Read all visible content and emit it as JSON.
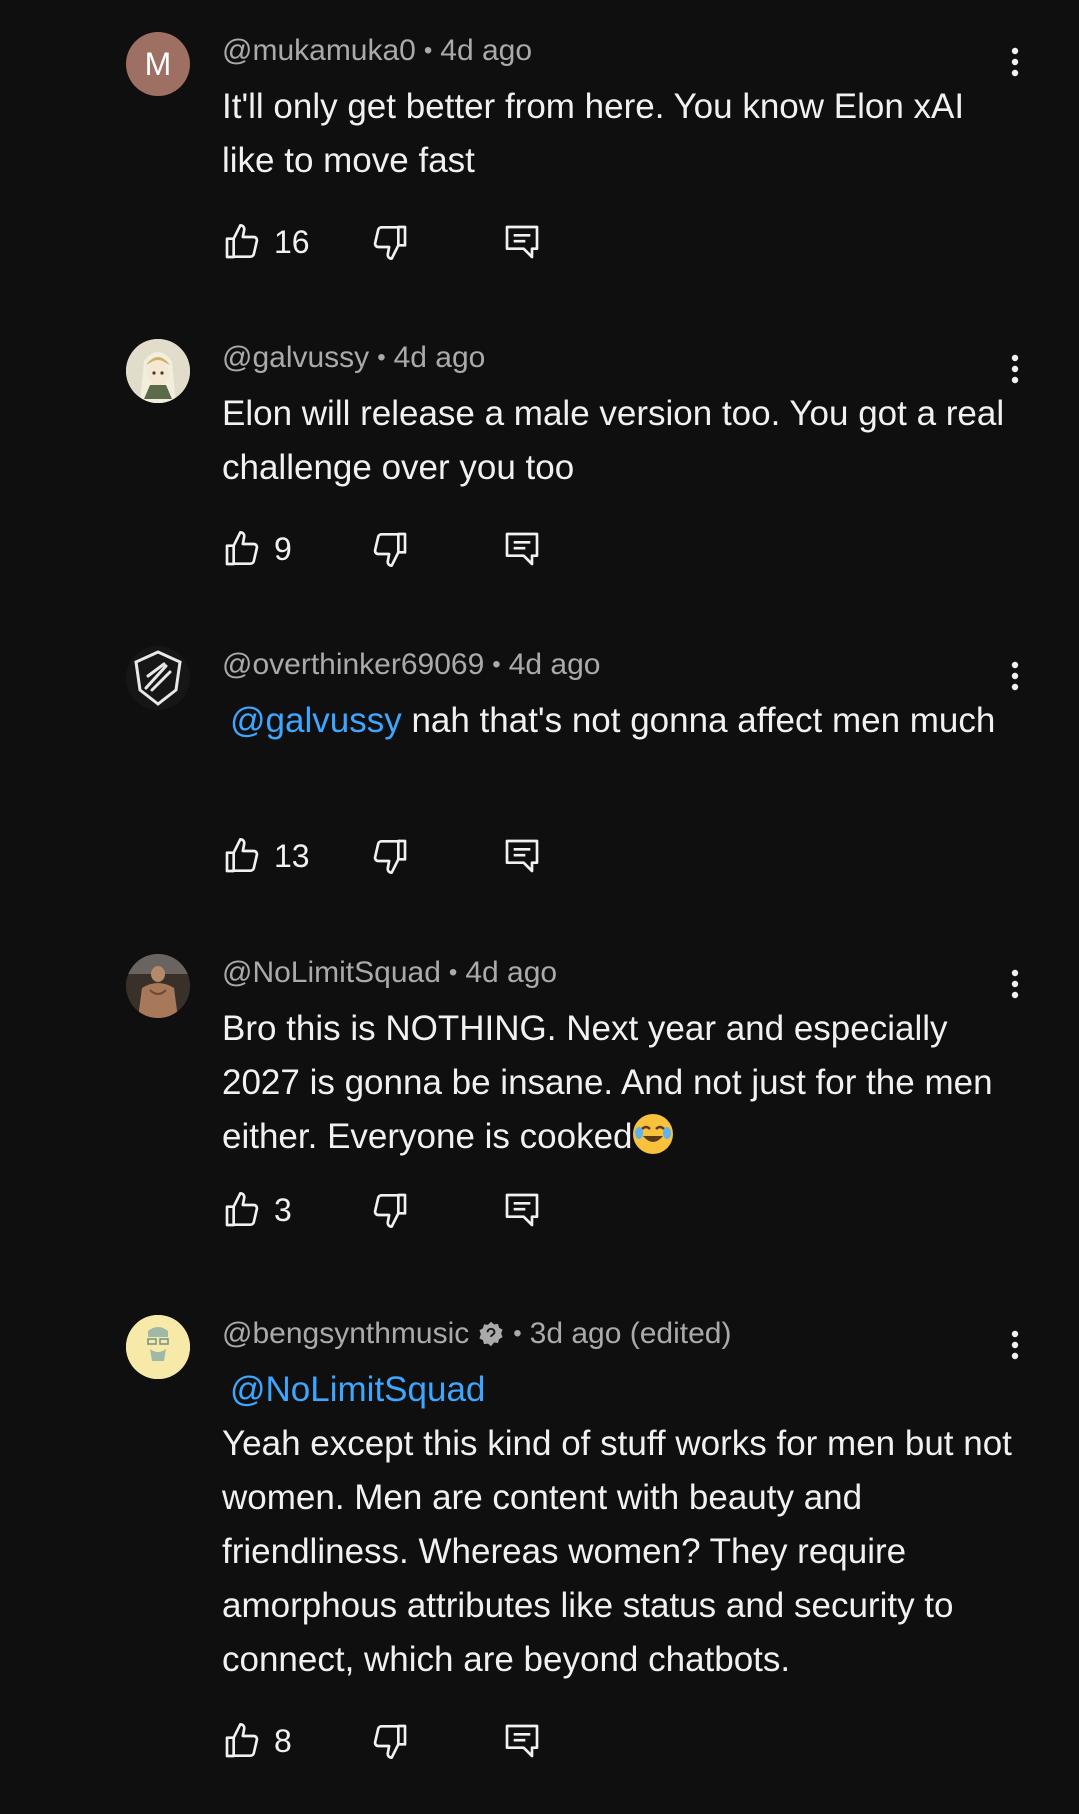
{
  "comments": [
    {
      "avatar_letter": "M",
      "handle": "@mukamuka0",
      "time": "4d ago",
      "mention": "",
      "text": "It'll only get better from here. You know Elon xAI like to move fast",
      "likes": "16"
    },
    {
      "avatar_letter": "",
      "handle": "@galvussy",
      "time": "4d ago",
      "mention": "",
      "text": "Elon will release a male version too. You got a real challenge over you too",
      "likes": "9"
    },
    {
      "avatar_letter": "",
      "handle": "@overthinker69069",
      "time": "4d ago",
      "mention": "@galvussy",
      "text": "nah that's not gonna affect men much",
      "likes": "13"
    },
    {
      "avatar_letter": "",
      "handle": "@NoLimitSquad",
      "time": "4d ago",
      "mention": "",
      "text": "Bro this is NOTHING. Next year and especially 2027 is gonna be insane. And not just for the men either. Everyone is cooked",
      "likes": "3"
    },
    {
      "avatar_letter": "",
      "handle": "@bengsynthmusic",
      "time": "3d ago (edited)",
      "mention": "@NoLimitSquad",
      "text": "Yeah except this kind of stuff works for men but not women. Men are content with beauty and friendliness. Whereas women? They require amorphous attributes like status and security to connect, which are beyond chatbots.",
      "likes": "8"
    }
  ],
  "colors": {
    "background": "#0f0f0f",
    "meta": "#aaaaaa",
    "text": "#f1f1f1",
    "mention": "#3ea6ff"
  },
  "icons": [
    "thumbs-up-icon",
    "thumbs-down-icon",
    "reply-icon",
    "more-vert-icon",
    "verified-icon",
    "laughing-emoji-icon"
  ]
}
